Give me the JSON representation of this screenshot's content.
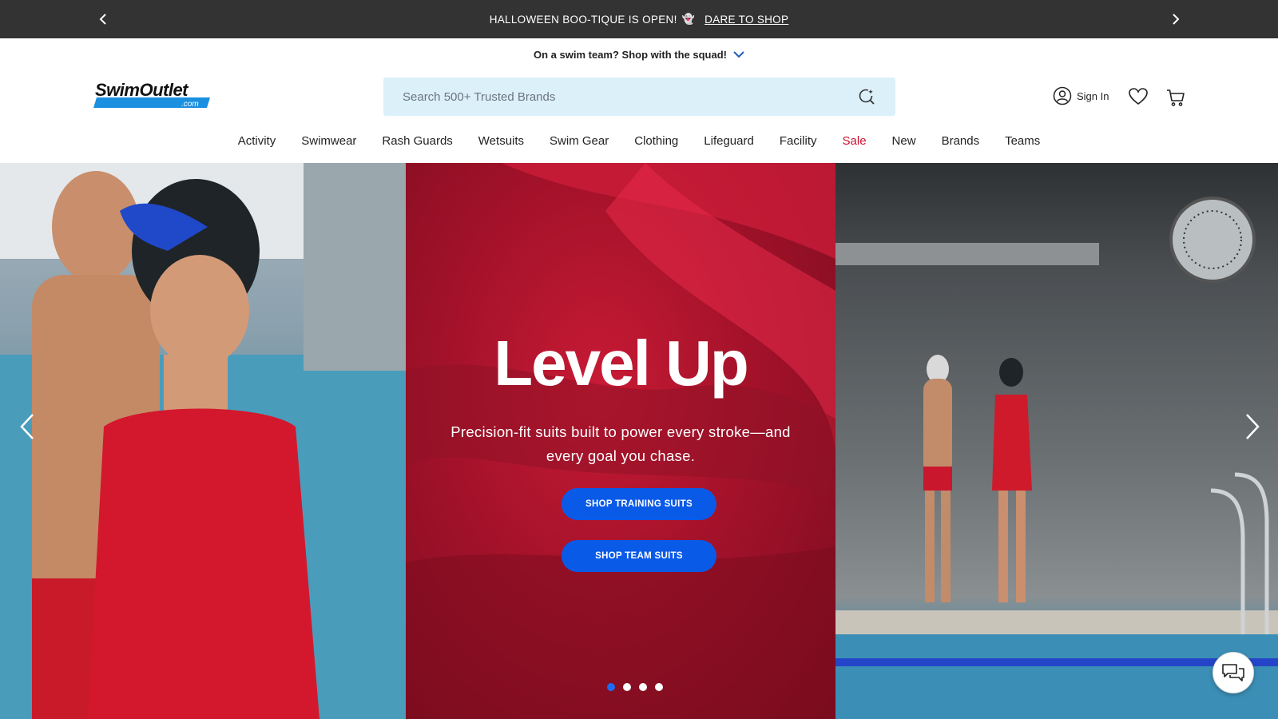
{
  "promo": {
    "message": "HALLOWEEN BOO-TIQUE IS OPEN!",
    "emoji": "👻",
    "cta": "DARE TO SHOP"
  },
  "team_bar": {
    "text": "On a swim team? Shop with the squad!"
  },
  "header": {
    "logo_main": "SwimOutlet",
    "logo_sub": ".com",
    "search_placeholder": "Search 500+ Trusted Brands",
    "sign_in": "Sign In"
  },
  "nav": {
    "items": [
      "Activity",
      "Swimwear",
      "Rash Guards",
      "Wetsuits",
      "Swim Gear",
      "Clothing",
      "Lifeguard",
      "Facility",
      "Sale",
      "New",
      "Brands",
      "Teams"
    ]
  },
  "hero": {
    "title": "Level Up",
    "subtitle": "Precision-fit suits built to power every stroke—and every goal you chase.",
    "button_primary": "SHOP TRAINING SUITS",
    "button_secondary": "SHOP TEAM SUITS",
    "slide_count": 4,
    "active_slide": 1
  },
  "colors": {
    "promo_bg": "#333333",
    "search_bg": "#dcf0fa",
    "sale": "#c8102e",
    "button": "#0a5ae8",
    "active_dot": "#1f6bf0"
  }
}
